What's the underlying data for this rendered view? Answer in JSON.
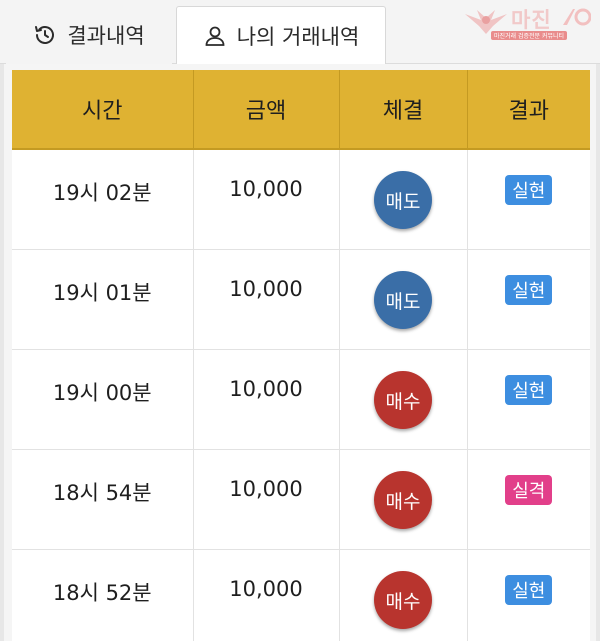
{
  "tabs": [
    {
      "label": "결과내역",
      "icon": "history-icon",
      "active": false
    },
    {
      "label": "나의 거래내역",
      "icon": "user-icon",
      "active": true
    }
  ],
  "logo": {
    "text": "마진",
    "sub": "마진거래 검증전문 커뮤니티"
  },
  "table": {
    "headers": [
      "시간",
      "금액",
      "체결",
      "결과"
    ],
    "rows": [
      {
        "time": "19시 02분",
        "amount": "10,000",
        "trade": "매도",
        "trade_type": "sell",
        "result": "실현",
        "result_type": "hit"
      },
      {
        "time": "19시 01분",
        "amount": "10,000",
        "trade": "매도",
        "trade_type": "sell",
        "result": "실현",
        "result_type": "hit"
      },
      {
        "time": "19시 00분",
        "amount": "10,000",
        "trade": "매수",
        "trade_type": "buy",
        "result": "실현",
        "result_type": "hit"
      },
      {
        "time": "18시 54분",
        "amount": "10,000",
        "trade": "매수",
        "trade_type": "buy",
        "result": "실격",
        "result_type": "miss"
      },
      {
        "time": "18시 52분",
        "amount": "10,000",
        "trade": "매수",
        "trade_type": "buy",
        "result": "실현",
        "result_type": "hit"
      }
    ]
  },
  "colors": {
    "header_bg": "#dfb232",
    "sell": "#3a6ea7",
    "buy": "#b8342e",
    "hit": "#3d8ee0",
    "miss": "#e23f8a"
  }
}
